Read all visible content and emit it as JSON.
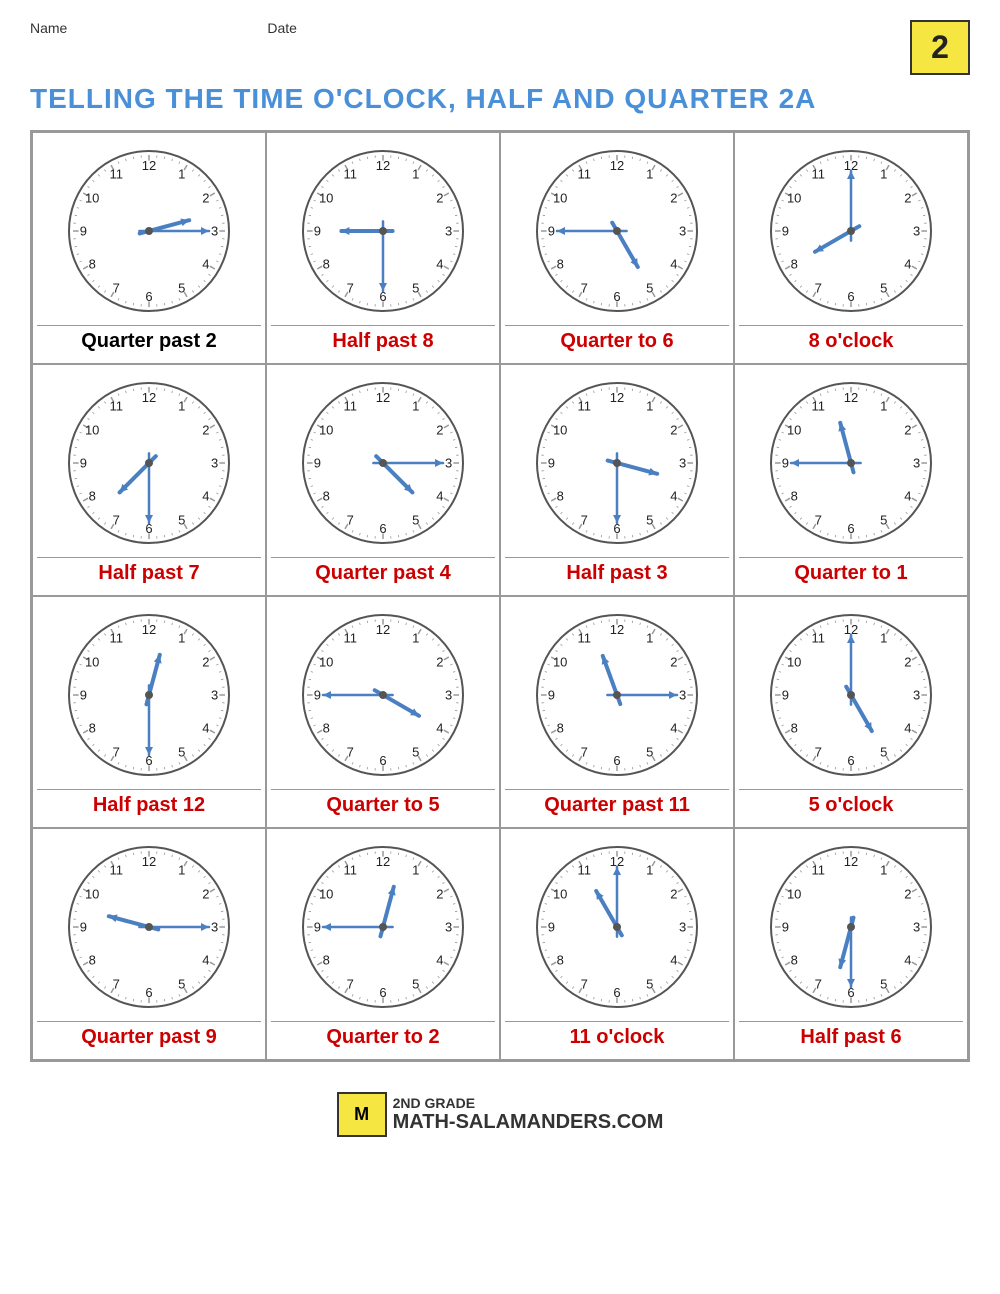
{
  "header": {
    "name_label": "Name",
    "date_label": "Date",
    "title": "TELLING THE TIME O'CLOCK, HALF AND QUARTER 2A",
    "grade": "2"
  },
  "clocks": [
    {
      "id": 1,
      "label": "Quarter past 2",
      "label_color": "black",
      "hour_angle": 75,
      "min_angle": 90,
      "description": "quarter past 2: minute at 3 (90deg right), hour between 2 and 3"
    },
    {
      "id": 2,
      "label": "Half past 8",
      "label_color": "red",
      "hour_angle": 270,
      "min_angle": 180,
      "description": "half past 8: minute at 6 (180), hour between 8 and 9"
    },
    {
      "id": 3,
      "label": "Quarter to 6",
      "label_color": "red",
      "hour_angle": 150,
      "min_angle": 270,
      "description": "quarter to 6: minute at 9 (270), hour between 5 and 6"
    },
    {
      "id": 4,
      "label": "8 o'clock",
      "label_color": "red",
      "hour_angle": 240,
      "min_angle": 0,
      "description": "8 oclock: minute at 12 (0), hour at 8"
    },
    {
      "id": 5,
      "label": "Half past 7",
      "label_color": "red",
      "hour_angle": 225,
      "min_angle": 180,
      "description": "half past 7"
    },
    {
      "id": 6,
      "label": "Quarter past 4",
      "label_color": "red",
      "hour_angle": 135,
      "min_angle": 90,
      "description": "quarter past 4"
    },
    {
      "id": 7,
      "label": "Half past 3",
      "label_color": "red",
      "hour_angle": 105,
      "min_angle": 180,
      "description": "half past 3"
    },
    {
      "id": 8,
      "label": "Quarter to 1",
      "label_color": "red",
      "hour_angle": 345,
      "min_angle": 270,
      "description": "quarter to 1"
    },
    {
      "id": 9,
      "label": "Half past 12",
      "label_color": "red",
      "hour_angle": 15,
      "min_angle": 180,
      "description": "half past 12"
    },
    {
      "id": 10,
      "label": "Quarter to 5",
      "label_color": "red",
      "hour_angle": 120,
      "min_angle": 270,
      "description": "quarter to 5"
    },
    {
      "id": 11,
      "label": "Quarter past 11",
      "label_color": "red",
      "hour_angle": 340,
      "min_angle": 90,
      "description": "quarter past 11"
    },
    {
      "id": 12,
      "label": "5 o'clock",
      "label_color": "red",
      "hour_angle": 150,
      "min_angle": 0,
      "description": "5 oclock"
    },
    {
      "id": 13,
      "label": "Quarter past 9",
      "label_color": "red",
      "hour_angle": 285,
      "min_angle": 90,
      "description": "quarter past 9"
    },
    {
      "id": 14,
      "label": "Quarter to 2",
      "label_color": "red",
      "hour_angle": 15,
      "min_angle": 270,
      "description": "quarter to 2"
    },
    {
      "id": 15,
      "label": "11 o'clock",
      "label_color": "red",
      "hour_angle": 330,
      "min_angle": 0,
      "description": "11 oclock"
    },
    {
      "id": 16,
      "label": "Half past 6",
      "label_color": "red",
      "hour_angle": 195,
      "min_angle": 180,
      "description": "half past 6"
    }
  ],
  "footer": {
    "grade_text": "2ND GRADE",
    "site_text": "ATH-SALAMANDERS.COM",
    "site_prefix": "M"
  }
}
